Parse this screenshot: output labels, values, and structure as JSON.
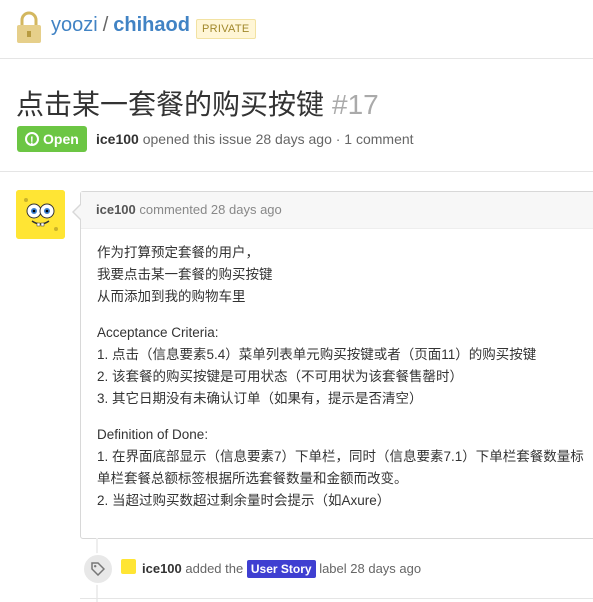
{
  "repo": {
    "owner": "yoozi",
    "separator": "/",
    "name": "chihaod",
    "visibility": "PRIVATE"
  },
  "issue": {
    "title": "点击某一套餐的购买按键",
    "number": "#17",
    "state": "Open",
    "author": "ice100",
    "opened_text": "opened this issue 28 days ago · 1 comment"
  },
  "comment": {
    "author": "ice100",
    "header_text": "commented 28 days ago",
    "paragraphs": [
      [
        "作为打算预定套餐的用户，",
        "我要点击某一套餐的购买按键",
        "从而添加到我的购物车里"
      ],
      [
        "Acceptance Criteria:",
        "1. 点击（信息要素5.4）菜单列表单元购买按键或者（页面11）的购买按键",
        "2. 该套餐的购买按键是可用状态（不可用状为该套餐售罄时）",
        "3. 其它日期没有未确认订单（如果有，提示是否清空）"
      ],
      [
        "Definition of Done:",
        "1. 在界面底部显示（信息要素7）下单栏，同时（信息要素7.1）下单栏套餐数量标",
        "单栏套餐总额标签根据所选套餐数量和金额而改变。",
        "2. 当超过购买数超过剩余量时会提示（如Axure）"
      ]
    ]
  },
  "event": {
    "actor": "ice100",
    "action": "added the",
    "label": "User Story",
    "suffix": "label 28 days ago"
  },
  "colors": {
    "link": "#4183c4",
    "open_green": "#6cc644",
    "label_blue": "#3f3fd1",
    "avatar_yellow": "#ffe534"
  },
  "icons": [
    "lock-icon",
    "open-issue-icon",
    "tag-icon",
    "spongebob-avatar"
  ]
}
